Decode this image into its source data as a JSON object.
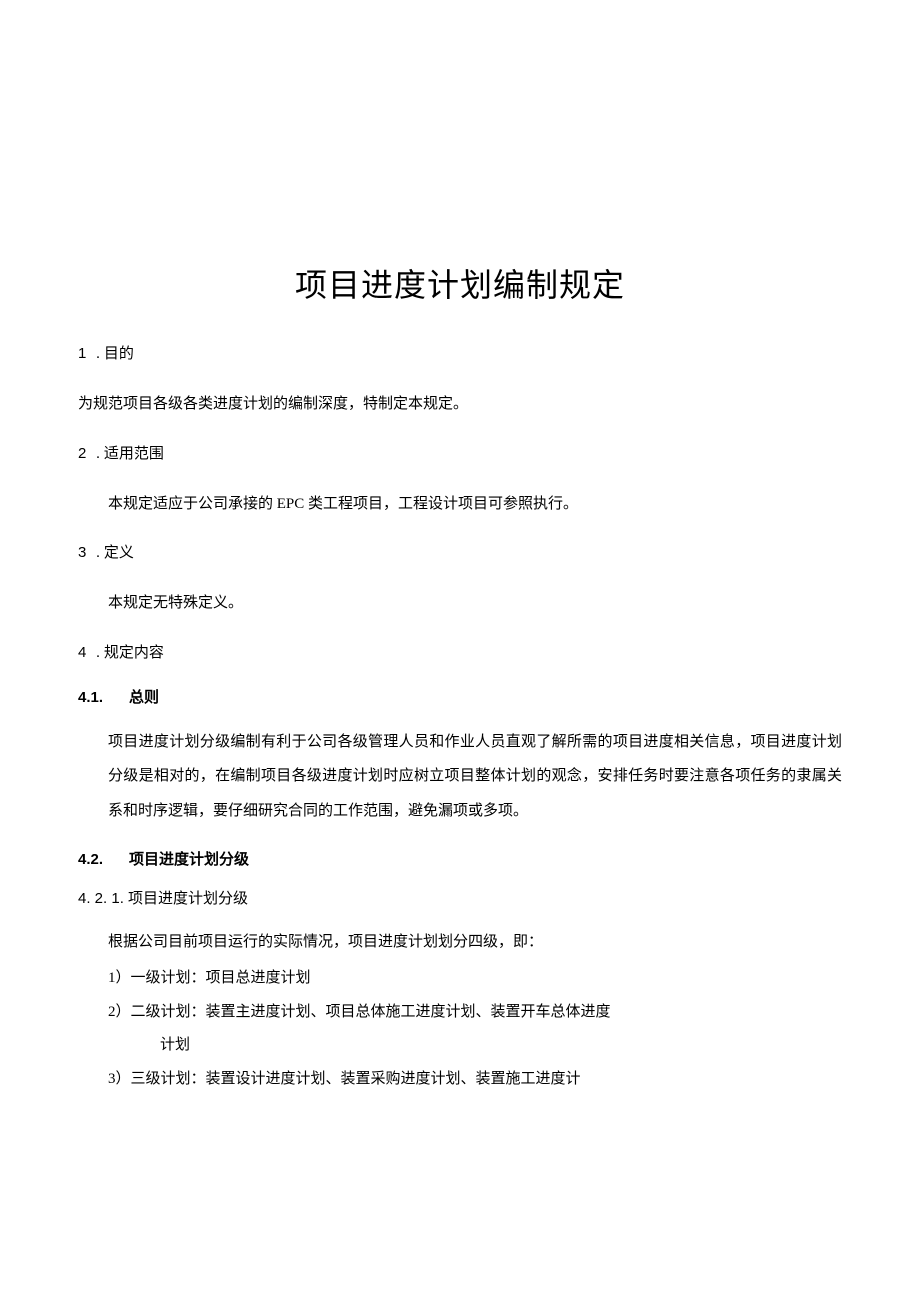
{
  "title": "项目进度计划编制规定",
  "s1": {
    "num": "1",
    "dot": ".",
    "label": "目的"
  },
  "p1": "为规范项目各级各类进度计划的编制深度，特制定本规定。",
  "s2": {
    "num": "2",
    "dot": ".",
    "label": "适用范围"
  },
  "p2": "本规定适应于公司承接的 EPC 类工程项目，工程设计项目可参照执行。",
  "s3": {
    "num": "3",
    "dot": ".",
    "label": "定义"
  },
  "p3": "本规定无特殊定义。",
  "s4": {
    "num": "4",
    "dot": ".",
    "label": "规定内容"
  },
  "s41": {
    "num": "4.1.",
    "label": "总则"
  },
  "p41": "项目进度计划分级编制有利于公司各级管理人员和作业人员直观了解所需的项目进度相关信息，项目进度计划分级是相对的，在编制项目各级进度计划时应树立项目整体计划的观念，安排任务时要注意各项任务的隶属关系和时序逻辑，要仔细研究合同的工作范围，避免漏项或多项。",
  "s42": {
    "num": "4.2.",
    "label": "项目进度计划分级"
  },
  "s421": "4. 2. 1. 项目进度计划分级",
  "p421": "根据公司目前项目运行的实际情况，项目进度计划划分四级，即：",
  "li1": "1）一级计划：项目总进度计划",
  "li2a": "2）二级计划：装置主进度计划、项目总体施工进度计划、装置开车总体进度",
  "li2b": "计划",
  "li3": "3）三级计划：装置设计进度计划、装置采购进度计划、装置施工进度计"
}
